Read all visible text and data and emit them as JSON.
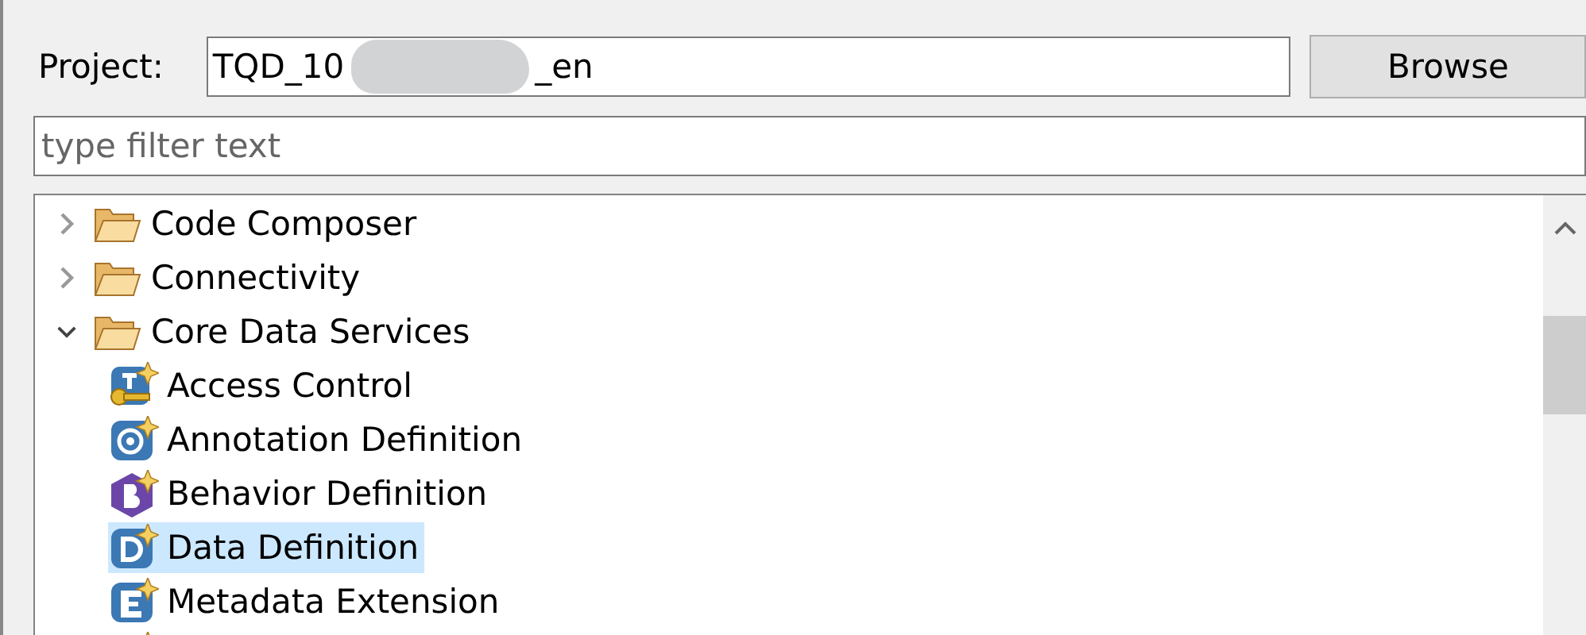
{
  "project": {
    "label": "Project:",
    "value_parts": [
      "TQD_10",
      "_en"
    ],
    "redacted": true
  },
  "browse_button": "Browse",
  "filter": {
    "placeholder": "type filter text"
  },
  "tree": [
    {
      "label": "Code Composer",
      "kind": "folder",
      "expanded": false,
      "selected": false
    },
    {
      "label": "Connectivity",
      "kind": "folder",
      "expanded": false,
      "selected": false
    },
    {
      "label": "Core Data Services",
      "kind": "folder",
      "expanded": true,
      "selected": false,
      "children": [
        {
          "label": "Access Control",
          "kind": "access",
          "selected": false
        },
        {
          "label": "Annotation Definition",
          "kind": "annotation",
          "selected": false
        },
        {
          "label": "Behavior Definition",
          "kind": "behavior",
          "selected": false
        },
        {
          "label": "Data Definition",
          "kind": "data",
          "selected": true
        },
        {
          "label": "Metadata Extension",
          "kind": "metadata",
          "selected": false
        },
        {
          "kind": "blank",
          "selected": false
        }
      ]
    }
  ]
}
